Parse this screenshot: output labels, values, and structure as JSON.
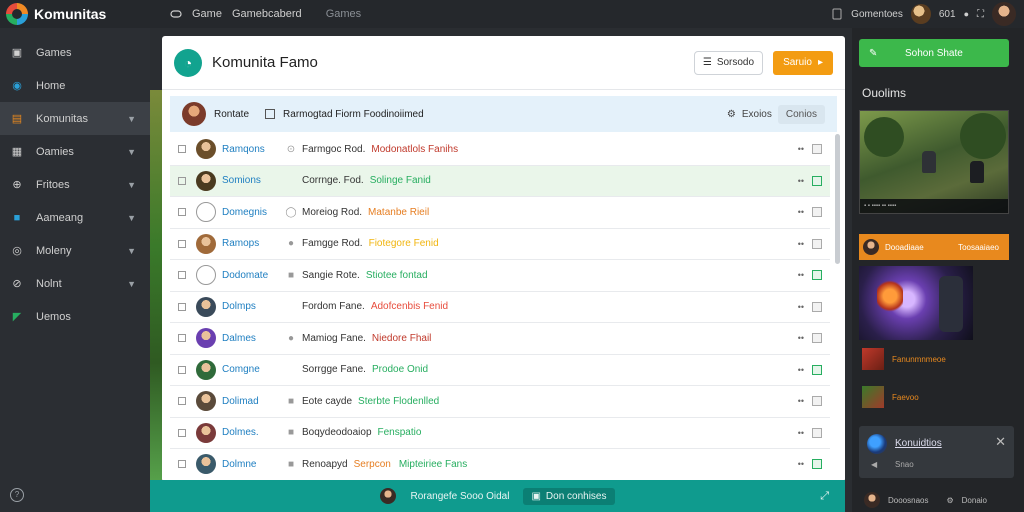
{
  "topbar": {
    "logo_text": "Komunitas",
    "nav_game": "Game",
    "nav_second": "Gamebcaberd",
    "nav_third": "Games",
    "right_label": "Gomentoes",
    "right_count": "601"
  },
  "sidebar": {
    "items": [
      {
        "label": "Games",
        "icon": "gamepad-icon"
      },
      {
        "label": "Home",
        "icon": "home-icon"
      },
      {
        "label": "Komunitas",
        "icon": "community-icon"
      },
      {
        "label": "Oamies",
        "icon": "grid-icon"
      },
      {
        "label": "Fritoes",
        "icon": "friends-icon"
      },
      {
        "label": "Aameang",
        "icon": "flag-icon"
      },
      {
        "label": "Moleny",
        "icon": "globe-icon"
      },
      {
        "label": "Nolnt",
        "icon": "compass-icon"
      },
      {
        "label": "Uemos",
        "icon": "palette-icon"
      }
    ]
  },
  "main": {
    "title": "Komunita Famo",
    "outline_button": "Sorsodo",
    "orange_button": "Saruio",
    "list_head": {
      "name": "Rontate",
      "text": "Rarmogtad Fiorm Foodinoiimed",
      "right_label": "Exoios",
      "right_button": "Conios"
    },
    "rows": [
      {
        "name": "Ramqons",
        "icon": "⊙",
        "text": "Farmgoc Rod.",
        "tag": "Modonatlols Fanihs",
        "tagColor": "#c0392b",
        "avatar": "#6b4e2a"
      },
      {
        "name": "Somions",
        "icon": "",
        "text": "Corrnge. Fod.",
        "tag": "Solinge Fanid",
        "tagColor": "#27ae60",
        "avatar": "#4a3a1f"
      },
      {
        "name": "Domegnis",
        "icon": "◯",
        "text": "Moreiog Rod.",
        "tag": "Matanbe Rieil",
        "tagColor": "#e67e22",
        "avatar": "#ffffff"
      },
      {
        "name": "Ramops",
        "icon": "●",
        "text": "Famgge Rod.",
        "tag": "Fiotegore Fenid",
        "tagColor": "#f1b50f",
        "avatar": "#a06a3a"
      },
      {
        "name": "Dodomate",
        "icon": "■",
        "text": "Sangie Rote.",
        "tag": "Stiotee fontad",
        "tagColor": "#27ae60",
        "avatar": "#ffffff"
      },
      {
        "name": "Dolmps",
        "icon": "",
        "text": "Fordom Fane.",
        "tag": "Adofcenbis Fenid",
        "tagColor": "#e74c3c",
        "avatar": "#3a4a5a"
      },
      {
        "name": "Dalmes",
        "icon": "●",
        "text": "Mamiog Fane.",
        "tag": "Niedore Fhail",
        "tagColor": "#c0392b",
        "avatar": "#6a3fb0"
      },
      {
        "name": "Comgne",
        "icon": "",
        "text": "Sorrgge Fane.",
        "tag": "Prodoe Onid",
        "tagColor": "#27ae60",
        "avatar": "#2f6a3a"
      },
      {
        "name": "Dolimad",
        "icon": "■",
        "text": "Eote cayde",
        "tag": "Sterbte Flodenlled",
        "tagColor": "#27ae60",
        "avatar": "#5a4a3a"
      },
      {
        "name": "Dolmes.",
        "icon": "■",
        "text": "Boqydeodoaiop",
        "tag": "Fenspatio",
        "tagColor": "#27ae60",
        "avatar": "#7a3a3a"
      },
      {
        "name": "Dolmne",
        "icon": "■",
        "text": "Renoapyd",
        "tag": "Serpcon",
        "tagColor": "#e67e22",
        "tag2": "Mipteiriee Fans",
        "tag2Color": "#27ae60",
        "avatar": "#3a5a6a"
      }
    ],
    "bottom_strip": {
      "left_text": "Rorangefe Sooo Oidal",
      "button_text": "Don conhises"
    }
  },
  "right": {
    "green_button": "Sohon Shate",
    "title": "Ouolims",
    "orange_left": "Dooadiaae",
    "orange_right": "Toosaaiaeo",
    "mini1": "Fanunmnmeoe",
    "mini2": "Faevoo",
    "notice_title": "Konuidtios",
    "notice_sub": "Snao",
    "footer_left": "Dooosnaos",
    "footer_right": "Donaio"
  },
  "colors": {
    "accent_green": "#3cb84b",
    "accent_orange": "#f39c12",
    "teal": "#0f9b8e",
    "link_blue": "#1f7fc1"
  }
}
